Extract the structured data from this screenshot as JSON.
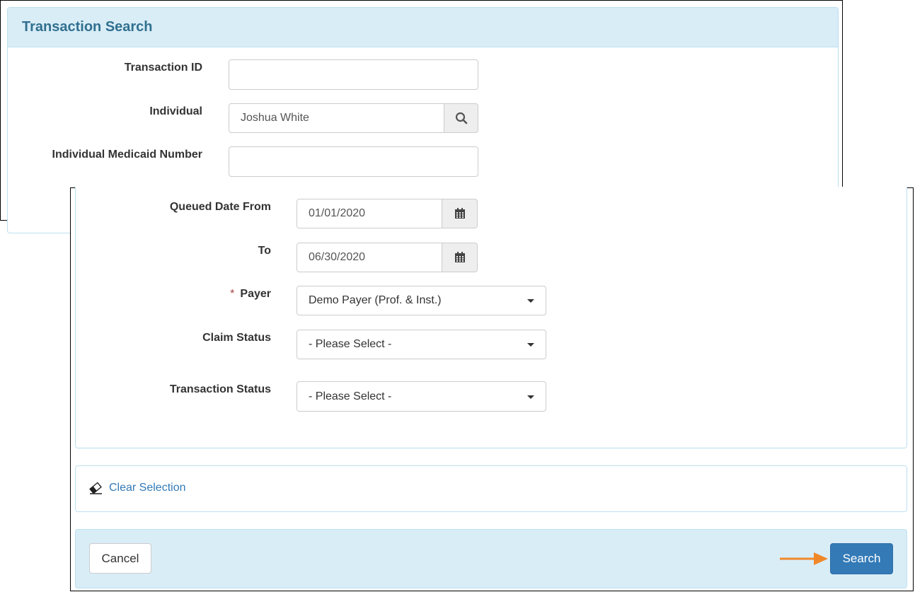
{
  "panel": {
    "title": "Transaction Search"
  },
  "fields": {
    "transaction_id": {
      "label": "Transaction ID",
      "value": ""
    },
    "individual": {
      "label": "Individual",
      "value": "Joshua White"
    },
    "medicaid_number": {
      "label": "Individual Medicaid Number",
      "value": ""
    },
    "queued_date_from": {
      "label": "Queued Date From",
      "value": "01/01/2020"
    },
    "queued_date_to": {
      "label": "To",
      "value": "06/30/2020"
    },
    "payer": {
      "label": "Payer",
      "required_marker": "*",
      "value": "Demo Payer (Prof. & Inst.)"
    },
    "claim_status": {
      "label": "Claim Status",
      "value": "- Please Select -"
    },
    "transaction_status": {
      "label": "Transaction Status",
      "value": "- Please Select -"
    }
  },
  "actions": {
    "clear_selection": "Clear Selection",
    "cancel": "Cancel",
    "search": "Search"
  },
  "icons": {
    "individual_lookup": "search-icon",
    "date_picker": "calendar-icon",
    "clear": "eraser-icon",
    "callout": "arrow-right-icon"
  },
  "colors": {
    "panel_header_bg": "#d9edf7",
    "title_text": "#31708f",
    "link": "#337ab7",
    "primary_button": "#337ab7",
    "required_marker": "#a94442",
    "callout_arrow": "#f0882a"
  }
}
